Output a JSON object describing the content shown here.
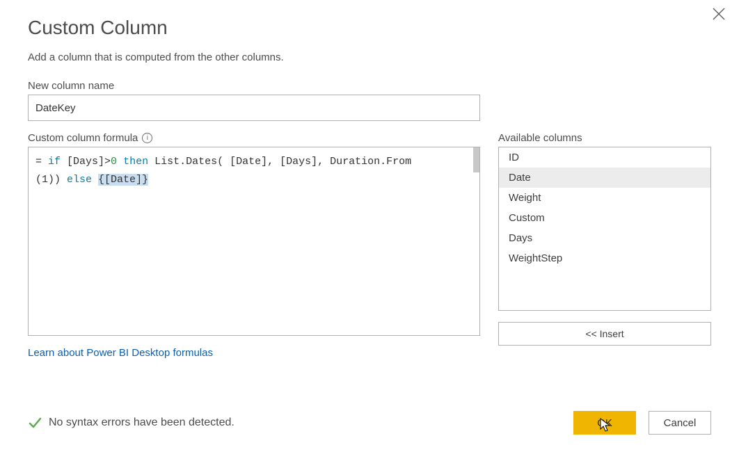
{
  "title": "Custom Column",
  "subtitle": "Add a column that is computed from the other columns.",
  "column_name": {
    "label": "New column name",
    "value": "DateKey"
  },
  "formula": {
    "label": "Custom column formula",
    "tokens": {
      "eq": "= ",
      "if": "if",
      "cond": " [Days]>",
      "zero": "0",
      "then": " then ",
      "body1": "List.Dates( [Date], [Days], Duration.From",
      "br_indent": "    (1)) ",
      "else": "else",
      "space": " ",
      "highlight": "{[Date]}"
    }
  },
  "available": {
    "label": "Available columns",
    "items": [
      "ID",
      "Date",
      "Weight",
      "Custom",
      "Days",
      "WeightStep"
    ],
    "selected_index": 1
  },
  "insert_label": "<< Insert",
  "learn_link": "Learn about Power BI Desktop formulas",
  "status_text": "No syntax errors have been detected.",
  "buttons": {
    "ok": "OK",
    "cancel": "Cancel"
  }
}
